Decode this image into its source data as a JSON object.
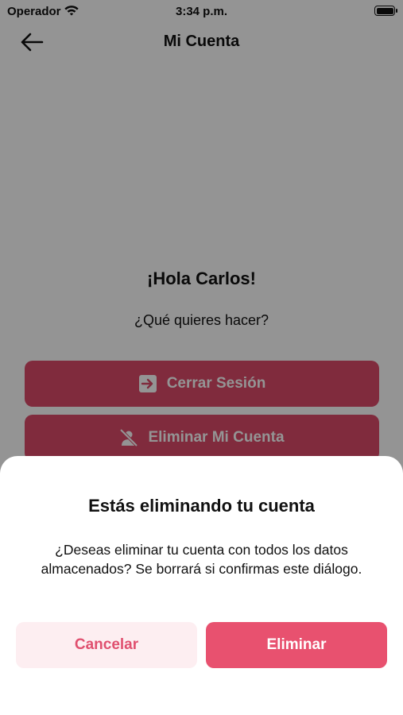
{
  "status_bar": {
    "carrier": "Operador",
    "time": "3:34 p.m."
  },
  "nav": {
    "title": "Mi Cuenta",
    "back_icon": "arrow-left-icon"
  },
  "greeting": "¡Hola Carlos!",
  "question": "¿Qué quieres hacer?",
  "actions": [
    {
      "label": "Cerrar Sesión",
      "icon": "logout-icon"
    },
    {
      "label": "Eliminar Mi Cuenta",
      "icon": "user-off-icon"
    }
  ],
  "dialog": {
    "title": "Estás eliminando tu cuenta",
    "message": "¿Deseas eliminar tu cuenta con todos los datos almacenados? Se borrará si confirmas este diálogo.",
    "cancel_label": "Cancelar",
    "confirm_label": "Eliminar"
  },
  "colors": {
    "accent": "#e8516f",
    "accent_light": "#fdeef1",
    "overlay": "rgba(0,0,0,0.42)"
  }
}
